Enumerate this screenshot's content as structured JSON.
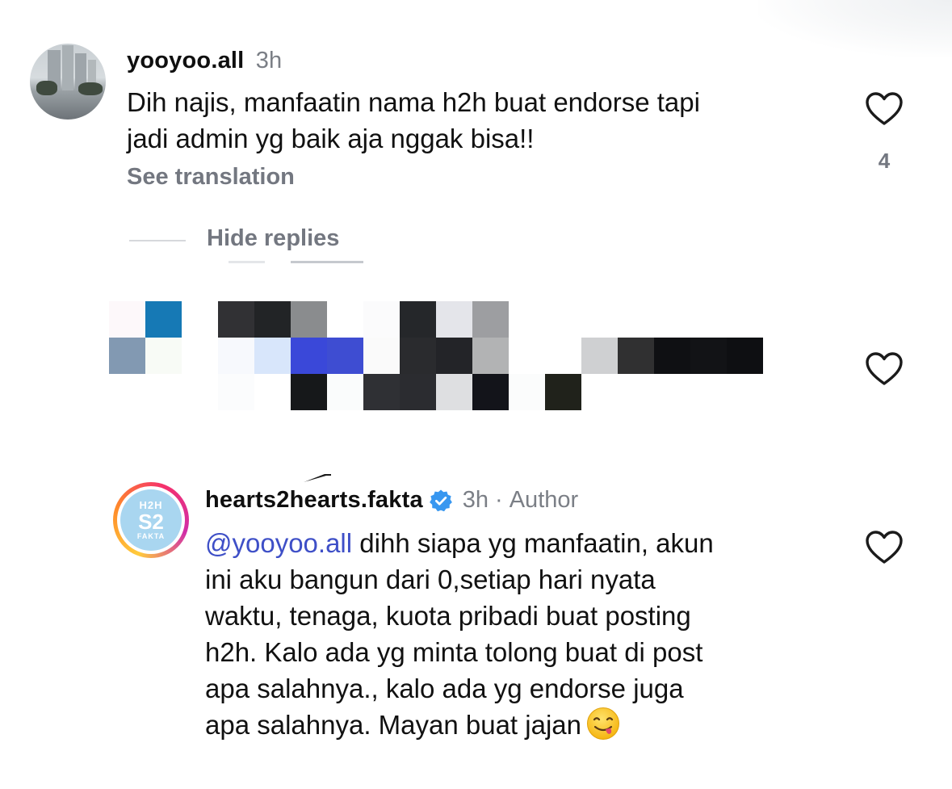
{
  "comments": [
    {
      "username": "yooyoo.all",
      "time": "3h",
      "text_line1": "Dih najis, manfaatin nama h2h buat endorse tapi",
      "text_line2": "jadi admin yg baik aja nggak bisa!!",
      "see_translation": "See translation",
      "like_count": "4"
    }
  ],
  "hide_replies_label": "Hide replies",
  "author_comment": {
    "username": "hearts2hearts.fakta",
    "time": "3h",
    "separator": "·",
    "author_label": "Author",
    "mention": "@yooyoo.all",
    "line1_rest": " dihh siapa yg manfaatin, akun",
    "line2": "ini aku bangun dari 0,setiap hari nyata",
    "line3": "waktu, tenaga, kuota pribadi buat posting",
    "line4": "h2h. Kalo ada yg minta tolong buat di post",
    "line5": "apa salahnya., kalo ada yg endorse juga",
    "line6": "apa salahnya. Mayan buat jajan",
    "emoji": "face-savoring-food-emoji",
    "avatar_logo": {
      "top": "H2H",
      "middle": "S2",
      "bottom": "FAKTA"
    }
  },
  "icons": {
    "heart": "heart-outline-icon",
    "verified": "verified-badge-icon"
  },
  "colors": {
    "secondary_text": "#737780",
    "mention": "#3e4fc7",
    "verified": "#3897f0"
  }
}
